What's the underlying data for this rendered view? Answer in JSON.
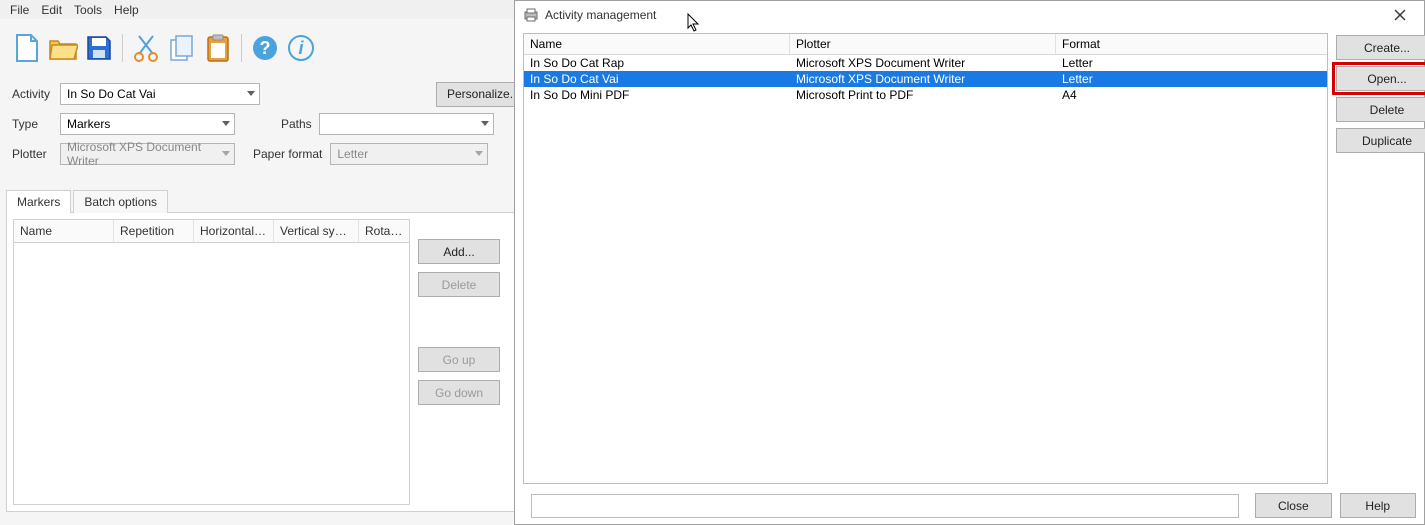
{
  "menubar": {
    "file": "File",
    "edit": "Edit",
    "tools": "Tools",
    "help": "Help"
  },
  "form": {
    "activity_label": "Activity",
    "activity_value": "In So Do Cat Vai",
    "personalize": "Personalize...",
    "type_label": "Type",
    "type_value": "Markers",
    "paths_label": "Paths",
    "paths_value": "",
    "plotter_label": "Plotter",
    "plotter_value": "Microsoft XPS Document Writer",
    "paper_label": "Paper format",
    "paper_value": "Letter"
  },
  "tabs": {
    "markers": "Markers",
    "batch": "Batch options"
  },
  "markers_grid": {
    "cols": {
      "name": "Name",
      "repetition": "Repetition",
      "hsym": "Horizontal s...",
      "vsym": "Vertical sym...",
      "rotation": "Rotation"
    }
  },
  "markers_buttons": {
    "add": "Add...",
    "delete": "Delete",
    "goup": "Go up",
    "godown": "Go down"
  },
  "dialog": {
    "title": "Activity management",
    "cols": {
      "name": "Name",
      "plotter": "Plotter",
      "format": "Format"
    },
    "rows": [
      {
        "name": "In So Do Cat Rap",
        "plotter": "Microsoft XPS Document Writer",
        "format": "Letter",
        "selected": false
      },
      {
        "name": "In So Do Cat Vai",
        "plotter": "Microsoft XPS Document Writer",
        "format": "Letter",
        "selected": true
      },
      {
        "name": "In So Do Mini PDF",
        "plotter": "Microsoft Print to PDF",
        "format": "A4",
        "selected": false
      }
    ],
    "buttons": {
      "create": "Create...",
      "open": "Open...",
      "delete": "Delete",
      "duplicate": "Duplicate",
      "close": "Close",
      "help": "Help"
    }
  }
}
